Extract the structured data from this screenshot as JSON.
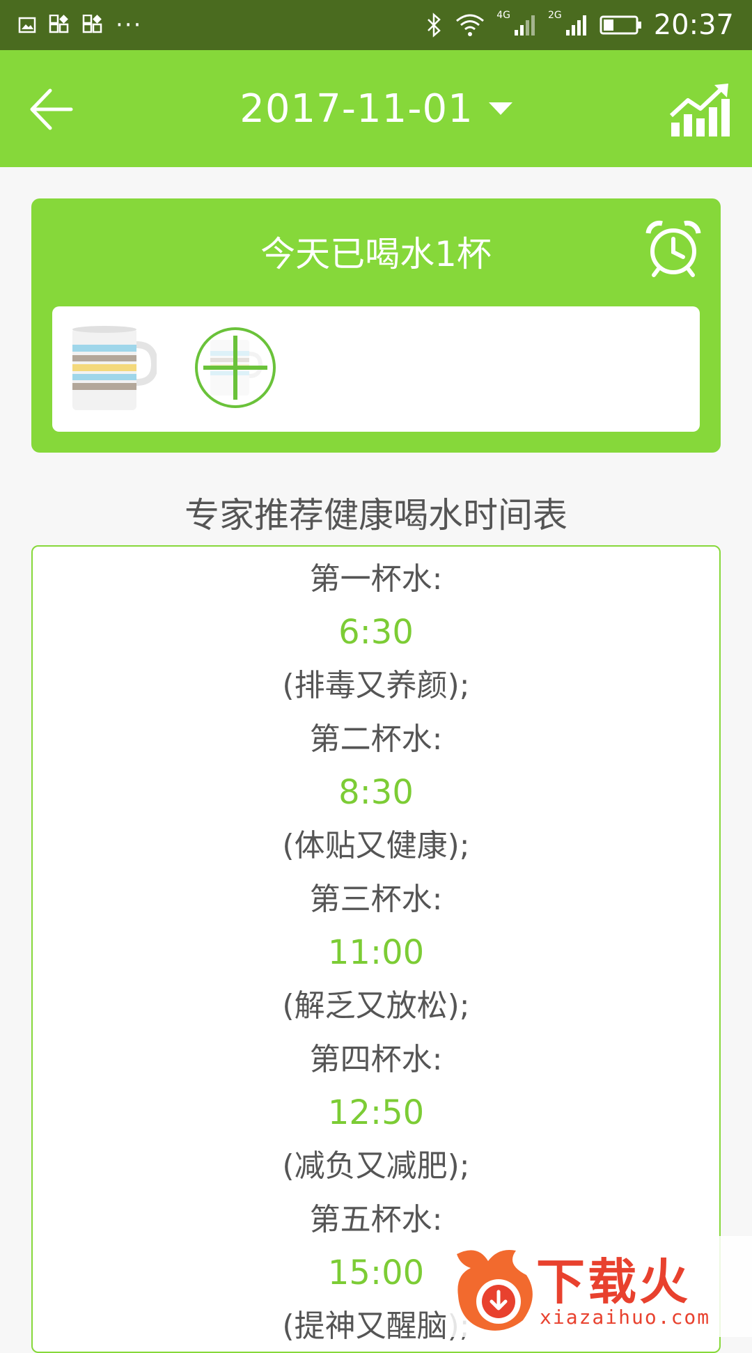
{
  "status_bar": {
    "time": "20:37",
    "more": "···",
    "net_4g": "4G",
    "net_2g": "2G",
    "icons": [
      "image-icon",
      "app-grid-icon",
      "app-grid-icon",
      "bluetooth-icon",
      "wifi-icon",
      "signal-icon",
      "signal-icon",
      "battery-icon"
    ]
  },
  "app_bar": {
    "date": "2017-11-01",
    "icons": [
      "back-arrow-icon",
      "dropdown-caret-icon",
      "trend-chart-icon"
    ]
  },
  "water_card": {
    "title": "今天已喝水1杯",
    "alarm_icon": "alarm-clock-icon",
    "cups_drunk": 1
  },
  "schedule": {
    "heading": "专家推荐健康喝水时间表",
    "entries": [
      {
        "label": "第一杯水:",
        "time": "6:30",
        "desc": "(排毒又养颜);"
      },
      {
        "label": "第二杯水:",
        "time": "8:30",
        "desc": "(体贴又健康);"
      },
      {
        "label": "第三杯水:",
        "time": "11:00",
        "desc": "(解乏又放松);"
      },
      {
        "label": "第四杯水:",
        "time": "12:50",
        "desc": "(减负又减肥);"
      },
      {
        "label": "第五杯水:",
        "time": "15:00",
        "desc": "(提神又醒脑);"
      }
    ]
  },
  "watermark": {
    "text": "下载火",
    "url": "xiazaihuo.com"
  },
  "colors": {
    "accent": "#86d83a",
    "status_bar": "#4a6b1f",
    "time_text": "#7ccc35",
    "body_text": "#555555",
    "watermark": "#e8412e"
  }
}
